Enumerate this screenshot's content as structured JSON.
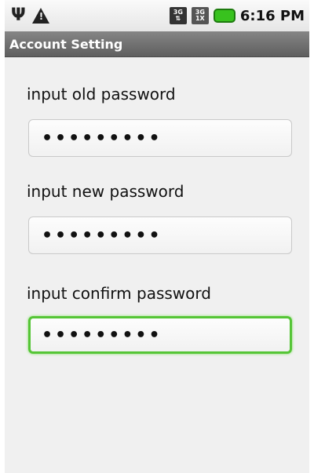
{
  "status_bar": {
    "left_icons": [
      "usb-icon",
      "warning-icon"
    ],
    "right_icons": [
      "3g-signal-icon",
      "3g-1x-signal-icon",
      "battery-icon"
    ],
    "time": "6:16 PM",
    "battery_color": "#38c21e"
  },
  "title_bar": {
    "title": "Account Setting"
  },
  "form": {
    "old_password": {
      "label": "input old password",
      "value": "•••••••••"
    },
    "new_password": {
      "label": "input new password",
      "value": "•••••••••"
    },
    "confirm_password": {
      "label": "input confirm password",
      "value": "•••••••••",
      "focused": true
    },
    "focus_color": "#55c536"
  }
}
